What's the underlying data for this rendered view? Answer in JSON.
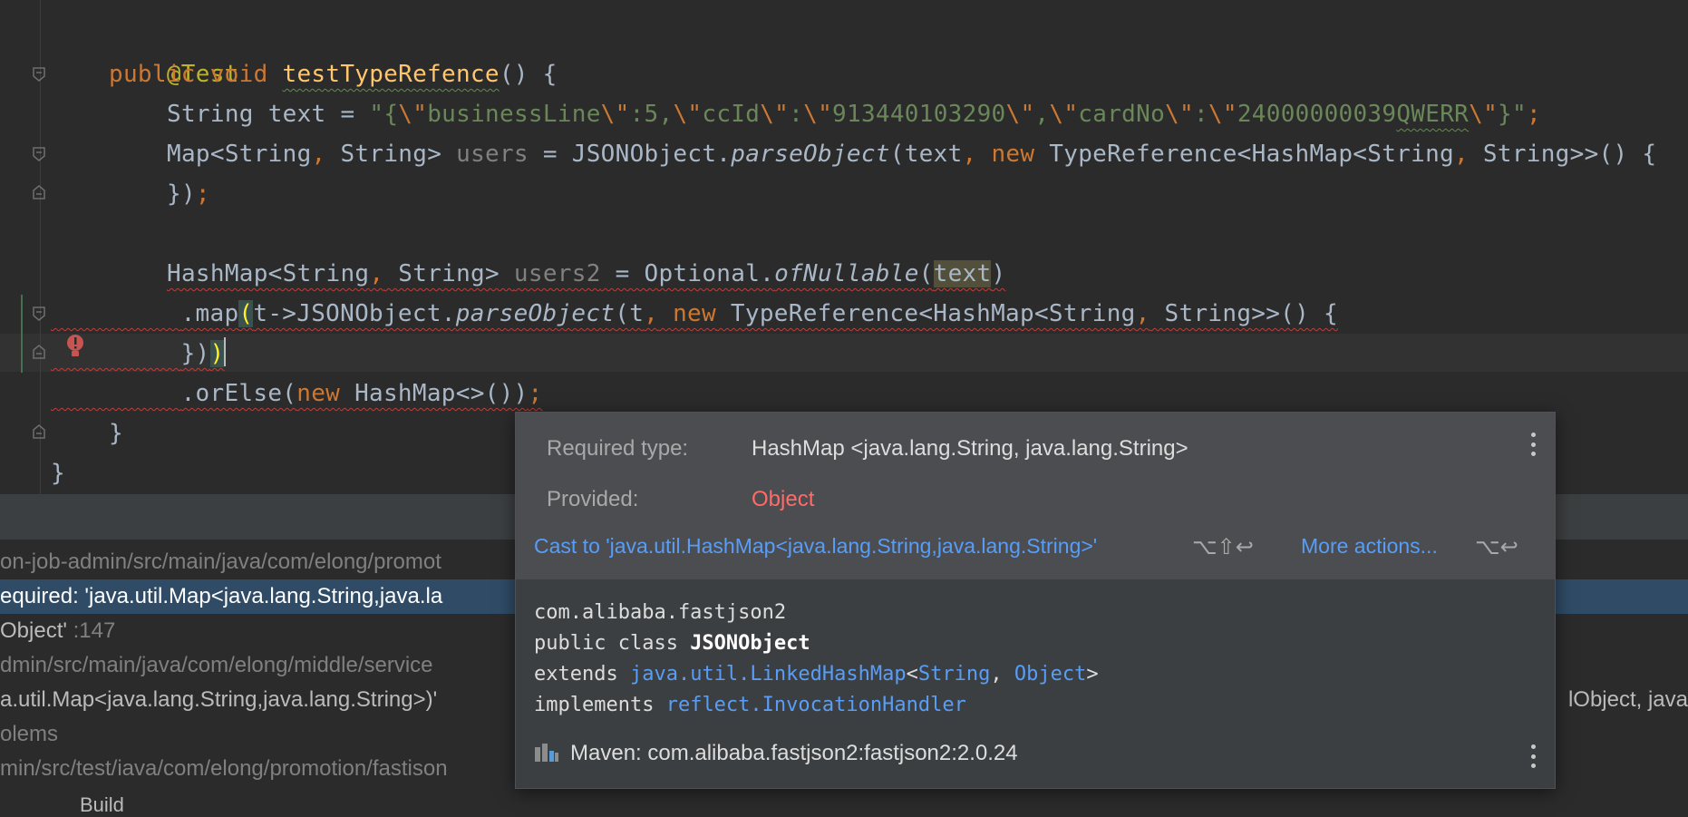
{
  "editor": {
    "lines": {
      "annotation": "@Test",
      "method_kw1": "public",
      "method_kw2": "void",
      "method_name": "testTypeRefence",
      "method_tail": "() {",
      "l3_type": "String",
      "l3_var": " text = ",
      "l3_str_open": "\"{",
      "l3_esc1": "\\\"",
      "l3_s1": "businessLine",
      "l3_esc2": "\\\"",
      "l3_s2": ":5,",
      "l3_esc3": "\\\"",
      "l3_s3": "ccId",
      "l3_esc4": "\\\"",
      "l3_s4": ":",
      "l3_esc5": "\\\"",
      "l3_s5": "913440103290",
      "l3_esc6": "\\\"",
      "l3_s6": ",",
      "l3_esc7": "\\\"",
      "l3_s7": "cardNo",
      "l3_esc8": "\\\"",
      "l3_s8": ":",
      "l3_esc9": "\\\"",
      "l3_s9a": "24000000039",
      "l3_s9b": "QWERR",
      "l3_esc10": "\\\"",
      "l3_str_close": "}\"",
      "l3_semi": ";",
      "l4_a": "Map<String",
      "l4_comma1": ",",
      "l4_b": " String> ",
      "l4_var": "users",
      "l4_c": " = JSONObject.",
      "l4_call": "parseObject",
      "l4_d": "(text",
      "l4_comma2": ",",
      "l4_new": " new",
      "l4_e": " TypeReference<HashMap<String",
      "l4_comma3": ",",
      "l4_f": " String>>() {",
      "l5_a": "})",
      "l5_semi": ";",
      "l7_a": "HashMap<String",
      "l7_comma": ",",
      "l7_b": " String> ",
      "l7_var": "users2",
      "l7_c": " = Optional.",
      "l7_call": "ofNullable",
      "l7_d": "(",
      "l7_text": "text",
      "l7_e": ")",
      "l8_a": ".map",
      "l8_paren": "(",
      "l8_b": "t->JSONObject.",
      "l8_call": "parseObject",
      "l8_c": "(t",
      "l8_comma1": ",",
      "l8_new": " new",
      "l8_d": " TypeReference<HashMap<String",
      "l8_comma2": ",",
      "l8_e": " String>>() {",
      "l9_a": "})",
      "l9_paren": ")",
      "l10_a": ".orElse(",
      "l10_new": "new",
      "l10_b": " HashMap<>())",
      "l10_semi": ";",
      "l11": "}",
      "l12": "}"
    }
  },
  "problems": {
    "rows": [
      "on-job-admin/src/main/java/com/elong/promot",
      "equired: 'java.util.Map<java.lang.String,java.la",
      "Object'",
      "dmin/src/main/java/com/elong/middle/service",
      "a.util.Map<java.lang.String,java.lang.String>)'",
      "olems",
      "min/src/test/iava/com/elong/promotion/fastison"
    ],
    "row3_suffix": ":147",
    "right_fragment": "lObject, java",
    "build_tab": "Build"
  },
  "popup": {
    "required_label": "Required type:",
    "required_value": "HashMap  <java.lang.String, java.lang.String>",
    "provided_label": "Provided:",
    "provided_value": "Object",
    "cast_action": "Cast to 'java.util.HashMap<java.lang.String,java.lang.String>'",
    "cast_shortcut": "⌥⇧↩",
    "more_actions": "More actions...",
    "more_shortcut": "⌥↩",
    "doc_package": "com.alibaba.fastjson2",
    "doc_decl_prefix": "public class ",
    "doc_class": "JSONObject",
    "doc_extends_kw": "extends ",
    "doc_extends_link": "java.util.LinkedHashMap",
    "doc_lt": "<",
    "doc_string_link": "String",
    "doc_sep": ", ",
    "doc_object_link": "Object",
    "doc_gt": ">",
    "doc_implements_kw": "implements ",
    "doc_implements_link": "reflect.InvocationHandler",
    "maven_text": "Maven: com.alibaba.fastjson2:fastjson2:2.0.24"
  },
  "colors": {
    "editor_bg": "#2b2b2b",
    "keyword": "#cc7832",
    "string": "#6a8759",
    "method": "#ffc66d",
    "error": "#ff6b68",
    "link": "#589df6",
    "selection": "#2f4b66"
  }
}
